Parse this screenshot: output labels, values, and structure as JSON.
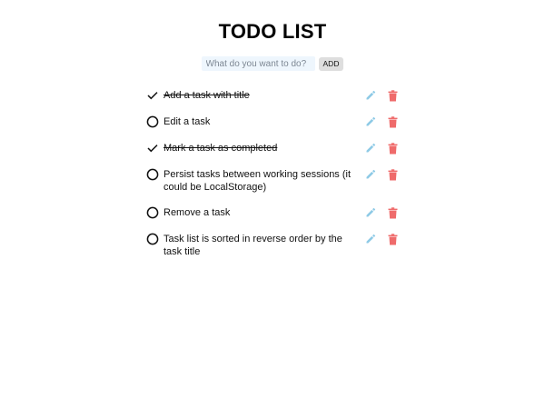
{
  "app": {
    "title": "TODO LIST"
  },
  "add_form": {
    "placeholder": "What do you want to do?",
    "add_label": "ADD"
  },
  "colors": {
    "edit_icon": "#8ecae6",
    "delete_icon": "#ef6b6b",
    "input_bg": "#eef6fd",
    "add_button_bg": "#dedede"
  },
  "tasks": [
    {
      "text": "Add a task with title",
      "completed": true
    },
    {
      "text": "Edit a task",
      "completed": false
    },
    {
      "text": "Mark a task as completed",
      "completed": true
    },
    {
      "text": "Persist tasks between working sessions (it could be LocalStorage)",
      "completed": false
    },
    {
      "text": "Remove a task",
      "completed": false
    },
    {
      "text": "Task list is sorted in reverse order by the task title",
      "completed": false
    }
  ],
  "icons": {
    "completed": "check-icon",
    "pending": "circle-icon",
    "edit": "pencil-icon",
    "delete": "trash-icon"
  }
}
